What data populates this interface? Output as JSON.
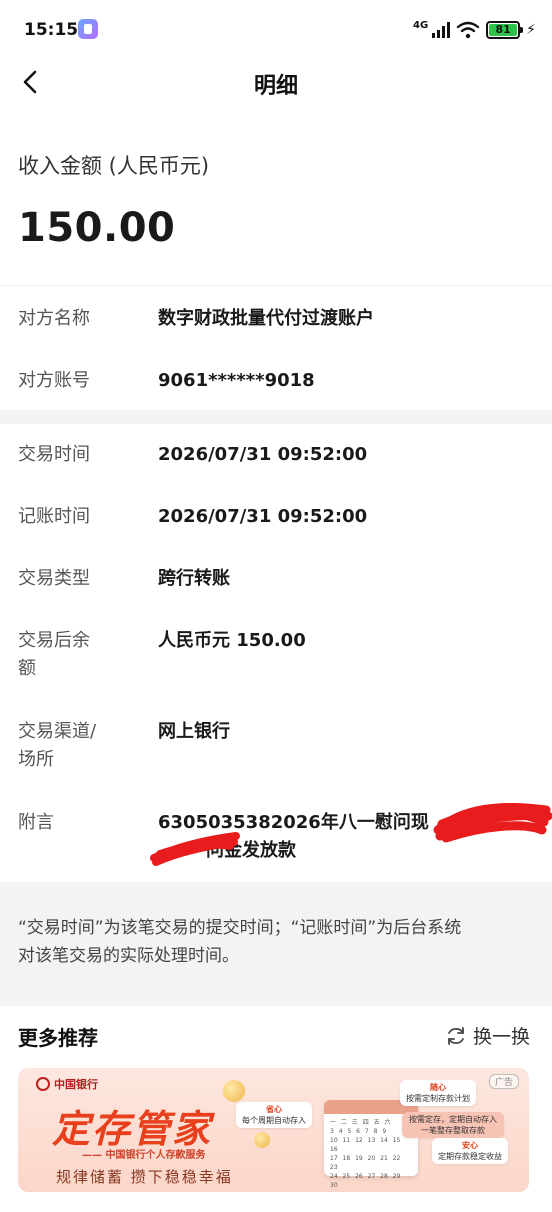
{
  "status_bar": {
    "time": "15:15",
    "network": "4G",
    "battery": "81"
  },
  "header": {
    "title": "明细"
  },
  "amount": {
    "label": "收入金额 (人民币元)",
    "value": "150.00"
  },
  "counterparty": [
    {
      "key": "对方名称",
      "value": "数字财政批量代付过渡账户"
    },
    {
      "key": "对方账号",
      "value": "9061******9018"
    }
  ],
  "details": [
    {
      "key": "交易时间",
      "value": "2026/07/31 09:52:00"
    },
    {
      "key": "记账时间",
      "value": "2026/07/31 09:52:00"
    },
    {
      "key": "交易类型",
      "value": "跨行转账"
    },
    {
      "key_line1": "交易后余",
      "key_line2": "额",
      "value": "人民币元 150.00"
    },
    {
      "key_line1": "交易渠道/",
      "key_line2": "场所",
      "value": "网上银行"
    },
    {
      "key": "附言",
      "value_line1": "6305035382026年八一慰问现",
      "value_line2": "问金发放款"
    }
  ],
  "note": {
    "line1": "“交易时间”为该笔交易的提交时间；“记账时间”为后台系统",
    "line2": "对该笔交易的实际处理时间。"
  },
  "more": {
    "title": "更多推荐",
    "refresh_label": "换一换"
  },
  "ad": {
    "bank_name": "中国银行",
    "tag": "广告",
    "headline": "定存管家",
    "subline": "—— 中国银行个人存款服务",
    "slogan": "规律储蓄 攒下稳稳幸福",
    "chip1_title": "省心",
    "chip1_text": "每个周期自动存入",
    "chip2_title": "随心",
    "chip2_text": "按需定制存款计划",
    "chip3_text": "按需定存，定期自动存入一笔整存整取存款",
    "chip4_title": "安心",
    "chip4_text": "定期存款稳定收益"
  },
  "colors": {
    "accent_red": "#e8401c",
    "battery_green": "#2fc24a",
    "band_gray": "#f3f3f3"
  }
}
